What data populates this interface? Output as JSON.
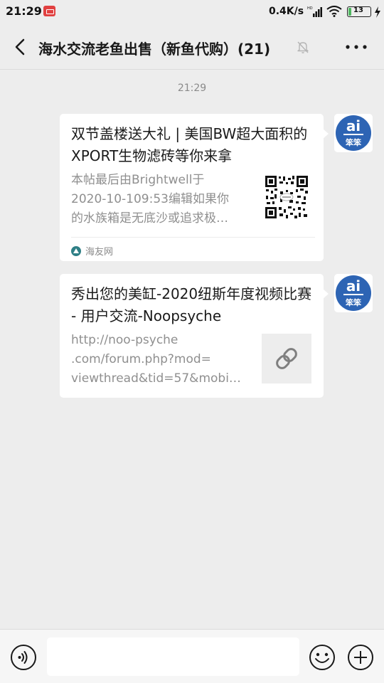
{
  "status_bar": {
    "time": "21:29",
    "net_speed": "0.4K/s",
    "battery_level": 13,
    "battery_text": "13"
  },
  "header": {
    "title": "海水交流老鱼出售（新鱼代购）(21)",
    "icons": [
      "back-icon",
      "mute-icon",
      "more-icon"
    ]
  },
  "chat": {
    "timestamp": "21:29",
    "messages": [
      {
        "title": "双节盖楼送大礼 | 美国BW超大面积的XPORT生物滤砖等你来拿",
        "desc_lines": [
          "本帖最后由Brightwell于",
          "2020-10-109:53编辑如果你",
          "的水族箱是无底沙或追求极…"
        ],
        "thumbnail": "qr-code",
        "source": "海友网"
      },
      {
        "title": "秀出您的美缸-2020纽斯年度视频比赛 - 用户交流-Noopsyche",
        "desc_lines": [
          "http://noo-psyche",
          ".com/forum.php?mod=",
          "viewthread&tid=57&mobi…"
        ],
        "thumbnail": "link-icon"
      }
    ]
  },
  "input_bar": {
    "message_value": "",
    "icons": [
      "voice-icon",
      "emoji-icon",
      "plus-icon"
    ]
  },
  "colors": {
    "background": "#ededed",
    "card": "#ffffff",
    "avatar_brand": "#2d64b4",
    "source_icon": "#2f7f86"
  }
}
